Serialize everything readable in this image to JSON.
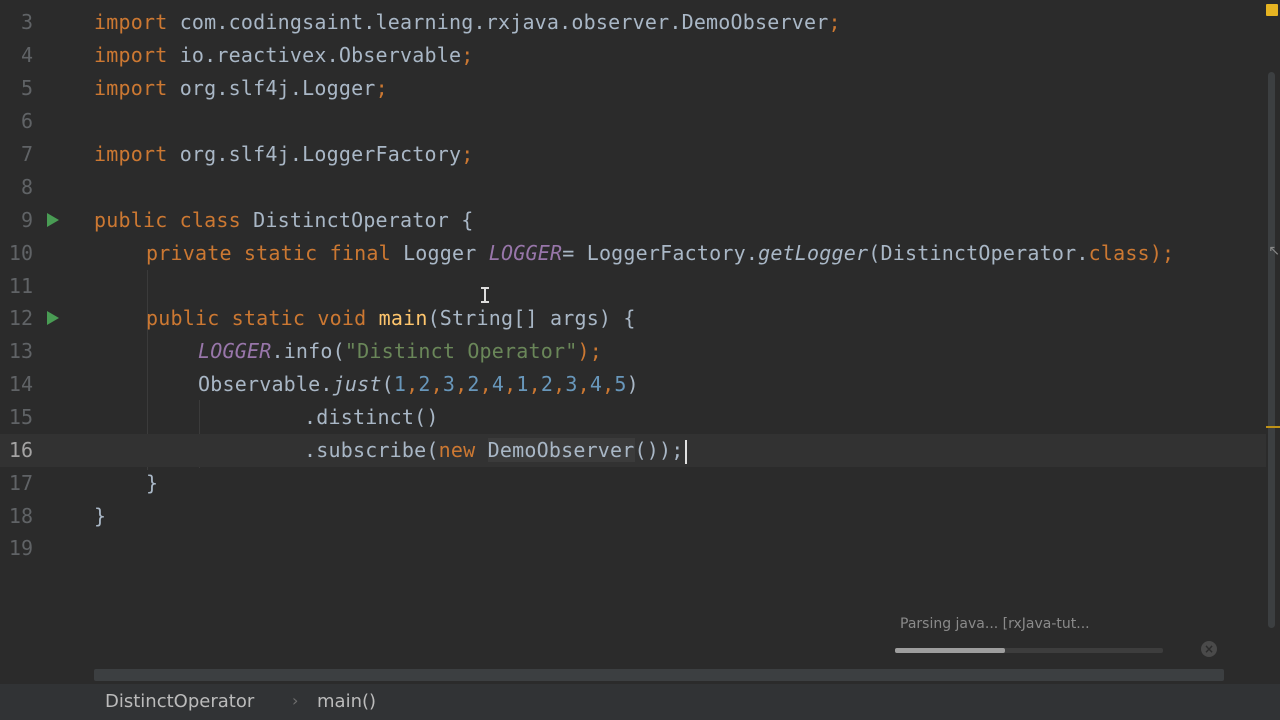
{
  "editor": {
    "line_numbers": [
      "3",
      "4",
      "5",
      "6",
      "7",
      "8",
      "9",
      "10",
      "11",
      "12",
      "13",
      "14",
      "15",
      "16",
      "17",
      "18",
      "19"
    ],
    "lines": {
      "l3_kw": "import",
      "l3_rest": " com.codingsaint.learning.rxjava.observer.DemoObserver",
      "l4_kw": "import",
      "l4_rest": " io.reactivex.Observable",
      "l5_kw": "import",
      "l5_rest": " org.slf4j.Logger",
      "l7_kw": "import",
      "l7_rest": " org.slf4j.LoggerFactory",
      "semicolon": ";",
      "l9_kw": "public class",
      "l9_rest": " DistinctOperator {",
      "l10_kw": "private static final",
      "l10_type": " Logger ",
      "l10_field": "LOGGER",
      "l10_eq": "= LoggerFactory.",
      "l10_call": "getLogger",
      "l10_arg": "(DistinctOperator.",
      "l10_class_kw": "class",
      "l10_end": ");",
      "l12_kw": "public static void",
      "l12_fn": "main",
      "l12_rest": "(String[] args) {",
      "l13_field": "LOGGER",
      "l13_call": ".info(",
      "l13_str": "\"Distinct Operator\"",
      "l13_end": ");",
      "l14_obj": "Observable.",
      "l14_call": "just",
      "l14_open": "(",
      "l14_nums": [
        "1",
        "2",
        "3",
        "2",
        "4",
        "1",
        "2",
        "3",
        "4",
        "5"
      ],
      "l14_close": ")",
      "l15": ".distinct()",
      "l16_call": ".subscribe(",
      "l16_kw": "new",
      "l16_cls": "DemoObserver",
      "l16_end": "());",
      "l17": "}",
      "l18": "}"
    }
  },
  "status": {
    "task_text": "Parsing java... [rxJava-tut...",
    "progress_fraction": 0.41
  },
  "breadcrumb": {
    "items": [
      "DistinctOperator",
      "main()"
    ],
    "separator": "›"
  },
  "colors": {
    "background": "#2b2b2b",
    "keyword": "#cc7832",
    "string": "#6a8759",
    "number": "#6897bb",
    "static_field": "#9876aa",
    "function": "#ffc66d",
    "run_icon": "#499c54"
  },
  "icons": [
    "run-gutter-icon",
    "cancel-task-icon",
    "warning-marker-icon",
    "breadcrumb-separator-icon"
  ]
}
